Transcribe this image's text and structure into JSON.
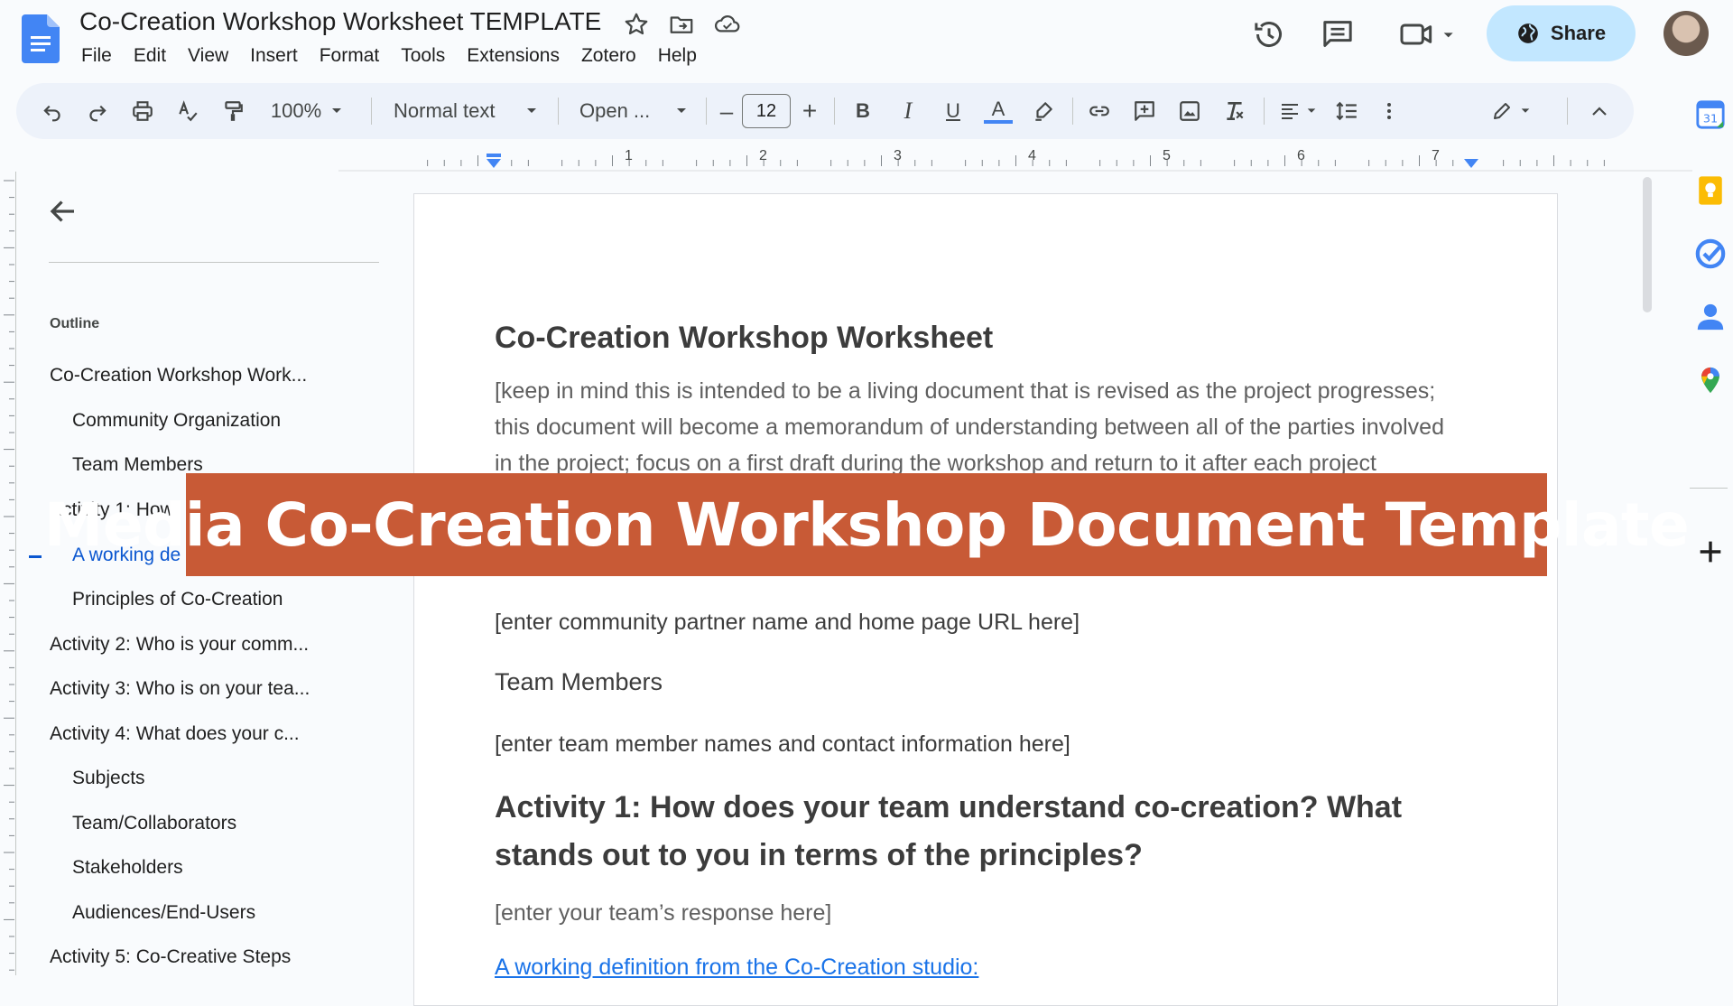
{
  "app": {
    "doc_title": "Co-Creation Workshop Worksheet TEMPLATE",
    "menu": [
      "File",
      "Edit",
      "View",
      "Insert",
      "Format",
      "Tools",
      "Extensions",
      "Zotero",
      "Help"
    ],
    "share_label": "Share",
    "brand_color": "#4285f4",
    "share_color": "#c2e7ff"
  },
  "toolbar": {
    "zoom": "100%",
    "style": "Normal text",
    "font": "Open ...",
    "font_size": "12",
    "bold": "B",
    "italic": "I",
    "underline": "U",
    "text_color": "A",
    "minus": "–",
    "plus": "+"
  },
  "ruler": {
    "numbers": [
      "1",
      "2",
      "3",
      "4",
      "5",
      "6",
      "7"
    ]
  },
  "outline": {
    "heading": "Outline",
    "items": [
      {
        "label": "Co-Creation Workshop Work...",
        "level": 1
      },
      {
        "label": "Community Organization",
        "level": 2
      },
      {
        "label": "Team Members",
        "level": 2
      },
      {
        "label": "Activity 1: How",
        "level": 1
      },
      {
        "label": "A working de",
        "level": 2,
        "active": true
      },
      {
        "label": "Principles of Co-Creation",
        "level": 2
      },
      {
        "label": "Activity 2: Who is your comm...",
        "level": 1
      },
      {
        "label": "Activity 3: Who is on your tea...",
        "level": 1
      },
      {
        "label": "Activity 4: What does your c...",
        "level": 1
      },
      {
        "label": "Subjects",
        "level": 2
      },
      {
        "label": "Team/Collaborators",
        "level": 2
      },
      {
        "label": "Stakeholders",
        "level": 2
      },
      {
        "label": "Audiences/End-Users",
        "level": 2
      },
      {
        "label": "Activity 5: Co-Creative Steps",
        "level": 1
      }
    ]
  },
  "document": {
    "title": "Co-Creation Workshop Worksheet",
    "intro_lines": [
      "[keep in mind this is intended to be a living document that is revised as the project progresses;",
      "this document will become a memorandum of understanding between all of the parties involved",
      "in the project; focus on a first draft during the workshop and return to it after each project"
    ],
    "community_placeholder": "[enter community partner name and home page URL here]",
    "team_heading": "Team Members",
    "team_placeholder": "[enter team member names and contact information here]",
    "activity1_line1": "Activity 1:  How does your team understand co-creation? What",
    "activity1_line2": "stands out to you in terms of the principles?",
    "activity1_placeholder": "[enter your team’s response here]",
    "working_def_link": "A working definition from the Co-Creation studio:"
  },
  "banner": {
    "text": "Media Co-Creation Workshop Document Template",
    "color": "#c85a36"
  }
}
